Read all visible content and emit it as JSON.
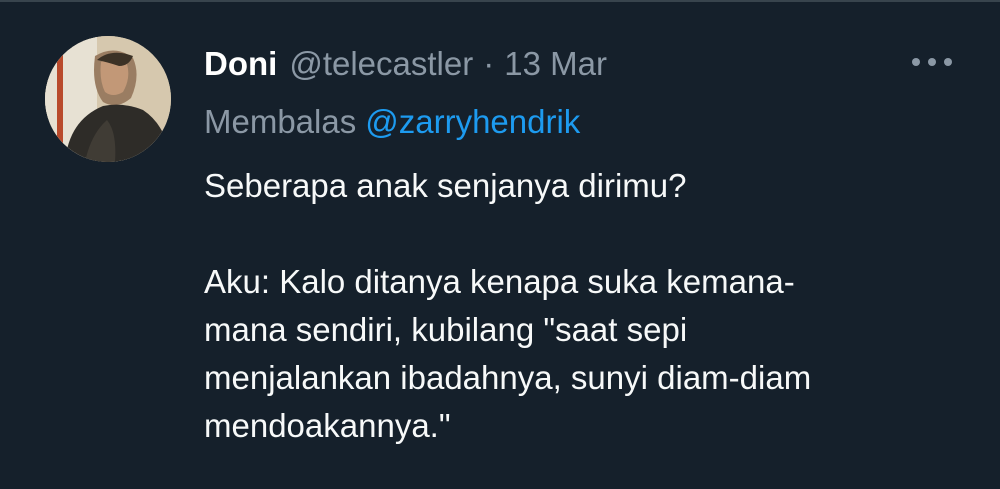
{
  "tweet": {
    "author_name": "Doni",
    "author_handle": "@telecastler",
    "separator": "·",
    "date": "13 Mar",
    "reply_prefix": "Membalas",
    "reply_to": "@zarryhendrik",
    "text_line_1": "Seberapa anak senjanya dirimu?",
    "text_para_2_line_1": "Aku: Kalo ditanya kenapa suka kemana-",
    "text_para_2_line_2": "mana sendiri, kubilang \"saat sepi",
    "text_para_2_line_3": "menjalankan ibadahnya, sunyi diam-diam",
    "text_para_2_line_4": "mendoakannya.\""
  },
  "icons": {
    "more": "more-horizontal-icon",
    "avatar": "profile-avatar"
  },
  "colors": {
    "background": "#15202b",
    "secondary_text": "#8b98a5",
    "link": "#1d9bf0",
    "primary_text": "#ffffff"
  }
}
